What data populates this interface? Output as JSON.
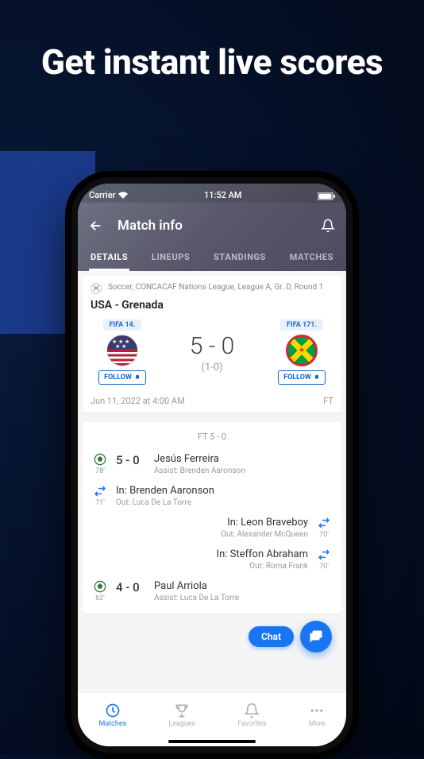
{
  "hero": "Get instant live scores",
  "status": {
    "carrier": "Carrier",
    "time": "11:52 AM"
  },
  "header": {
    "title": "Match info"
  },
  "tabs": {
    "details": "DETAILS",
    "lineups": "LINEUPS",
    "standings": "STANDINGS",
    "matches": "MATCHES"
  },
  "match": {
    "competition": "Soccer, CONCACAF Nations League, League A, Gr. D, Round 1",
    "title": "USA - Grenada",
    "home_fifa": "FIFA 14.",
    "away_fifa": "FIFA 171.",
    "score": "5 - 0",
    "halftime": "(1-0)",
    "follow_label": "FOLLOW",
    "date": "Jun 11, 2022 at 4:00 AM",
    "status": "FT"
  },
  "ft_header": "FT 5 - 0",
  "events": [
    {
      "side": "left",
      "type": "goal",
      "minute": "78'",
      "score": "5 - 0",
      "main": "Jesús Ferreira",
      "sub": "Assist: Brenden Aaronson"
    },
    {
      "side": "left",
      "type": "sub",
      "minute": "71'",
      "main": "In: Brenden Aaronson",
      "sub": "Out: Luca De La Torre"
    },
    {
      "side": "right",
      "type": "sub",
      "minute": "70'",
      "main": "In: Leon Braveboy",
      "sub": "Out: Alexander McQueen"
    },
    {
      "side": "right",
      "type": "sub",
      "minute": "70'",
      "main": "In: Steffon Abraham",
      "sub": "Out: Roma Frank"
    },
    {
      "side": "left",
      "type": "goal",
      "minute": "62'",
      "score": "4 - 0",
      "main": "Paul Arriola",
      "sub": "Assist: Luca De La Torre"
    }
  ],
  "chat_label": "Chat",
  "nav": {
    "matches": "Matches",
    "leagues": "Leagues",
    "favorites": "Favorites",
    "more": "More"
  }
}
